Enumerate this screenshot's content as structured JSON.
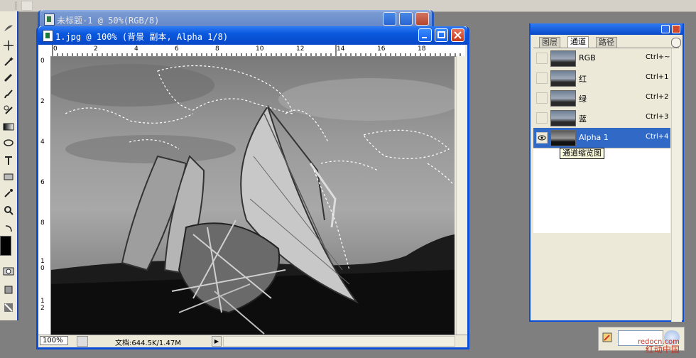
{
  "back_window": {
    "title": "未标题-1 @ 50%(RGB/8)"
  },
  "main_window": {
    "title": "1.jpg @ 100% (背景 副本, Alpha 1/8)"
  },
  "ruler": {
    "top_labels": [
      "0",
      "2",
      "4",
      "6",
      "8",
      "10",
      "12",
      "14",
      "16",
      "18"
    ],
    "left_labels": [
      "0",
      "2",
      "4",
      "6",
      "8",
      "1 0",
      "1 2"
    ]
  },
  "status": {
    "zoom": "100%",
    "docinfo": "文档:644.5K/1.47M"
  },
  "panel": {
    "tabs": [
      "图层",
      "通道",
      "路径"
    ],
    "active_tab": "通道",
    "channels": [
      {
        "name": "RGB",
        "shortcut": "Ctrl+~",
        "selected": false,
        "visible": false
      },
      {
        "name": "红",
        "shortcut": "Ctrl+1",
        "selected": false,
        "visible": false
      },
      {
        "name": "绿",
        "shortcut": "Ctrl+2",
        "selected": false,
        "visible": false
      },
      {
        "name": "蓝",
        "shortcut": "Ctrl+3",
        "selected": false,
        "visible": false
      },
      {
        "name": "Alpha 1",
        "shortcut": "Ctrl+4",
        "selected": true,
        "visible": true
      }
    ],
    "tooltip": "通道缩览图"
  },
  "watermark": {
    "line1": "redocn.com",
    "line2": "红动中国"
  },
  "colors": {
    "xp_blue": "#0c4fd6",
    "selection": "#3169c6",
    "panel_bg": "#ece9d8"
  }
}
